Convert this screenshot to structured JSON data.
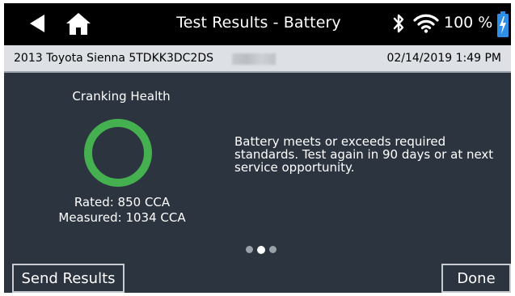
{
  "header": {
    "title": "Test Results - Battery",
    "battery_percent": "100 %",
    "icons": [
      "back-arrow-icon",
      "home-icon",
      "bluetooth-icon",
      "wifi-icon",
      "battery-charging-icon"
    ]
  },
  "vehicle": {
    "description": "2013 Toyota Sienna  5TDKK3DC2DS",
    "datetime": "02/14/2019 1:49 PM"
  },
  "cranking": {
    "label": "Cranking Health",
    "status_color": "#44b04f",
    "rated": "Rated:  850 CCA",
    "measured": "Measured:  1034 CCA"
  },
  "result_message": "Battery meets or exceeds required standards. Test again in 90 days or at next service opportunity.",
  "pager": {
    "count": 3,
    "active_index": 1
  },
  "buttons": {
    "send_results": "Send Results",
    "done": "Done"
  },
  "colors": {
    "background": "#2c3440",
    "topbar": "#000000",
    "vehicle_bar": "#dde0e4",
    "battery_charging": "#2f8ee6"
  }
}
